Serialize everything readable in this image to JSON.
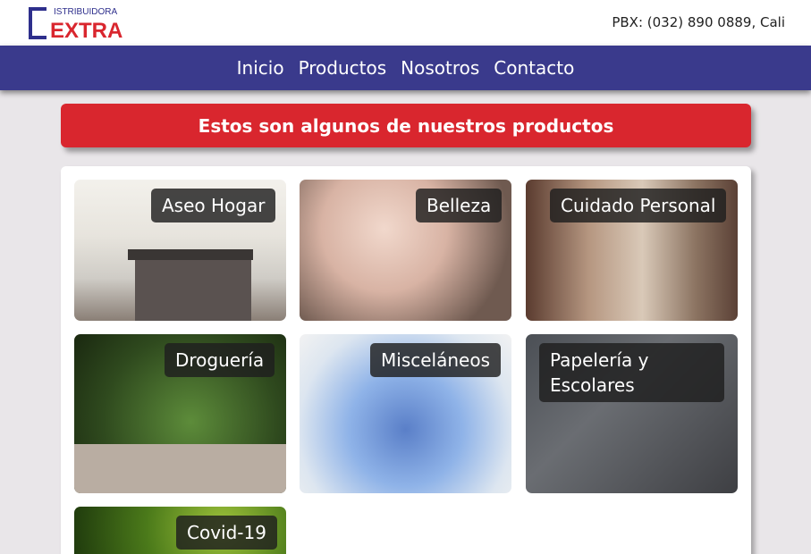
{
  "header": {
    "logo_top": "ISTRIBUIDORA",
    "logo_main": "EXTRA",
    "pbx": "PBX: (032) 890 0889, Cali"
  },
  "nav": {
    "items": [
      "Inicio",
      "Productos",
      "Nosotros",
      "Contacto"
    ]
  },
  "banner": {
    "title": "Estos son algunos de nuestros productos"
  },
  "categories": [
    "Aseo Hogar",
    "Belleza",
    "Cuidado Personal",
    "Droguería",
    "Misceláneos",
    "Papelería y Escolares",
    "Covid-19"
  ],
  "colors": {
    "nav_bg": "#3a3a8c",
    "banner_bg": "#d9262e",
    "logo_blue": "#2e2f8c",
    "logo_red": "#d9262e"
  }
}
